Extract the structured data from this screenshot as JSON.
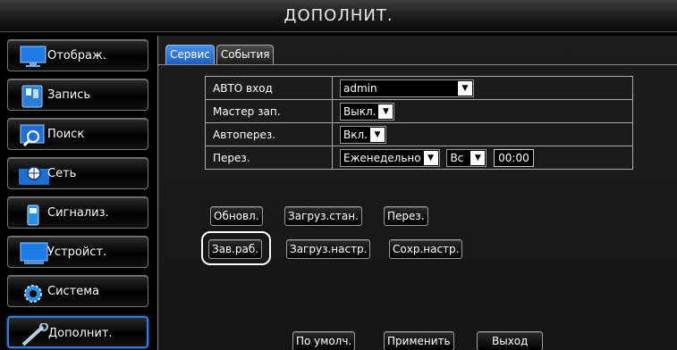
{
  "window": {
    "title": "ДОПОЛНИТ."
  },
  "sidebar": {
    "items": [
      {
        "label": "Отображ.",
        "icon": "monitor-icon"
      },
      {
        "label": "Запись",
        "icon": "record-icon"
      },
      {
        "label": "Поиск",
        "icon": "search-icon"
      },
      {
        "label": "Сеть",
        "icon": "network-icon"
      },
      {
        "label": "Сигнализ.",
        "icon": "alarm-icon"
      },
      {
        "label": "Устройст.",
        "icon": "device-icon"
      },
      {
        "label": "Система",
        "icon": "gear-icon"
      },
      {
        "label": "Дополнит.",
        "icon": "tools-icon"
      }
    ],
    "active_index": 7
  },
  "tabs": [
    {
      "label": "Сервис"
    },
    {
      "label": "События"
    }
  ],
  "settings": {
    "auto_login": {
      "label": "АВТО вход",
      "value": "admin"
    },
    "wizard": {
      "label": "Мастер зап.",
      "value": "Выкл."
    },
    "auto_reboot": {
      "label": "Автоперез.",
      "value": "Вкл."
    },
    "reboot": {
      "label": "Перез.",
      "period": "Еженедельно",
      "day": "Вс",
      "time": "00:00"
    }
  },
  "buttons": {
    "update": "Обновл.",
    "load_default": "Загруз.стан.",
    "reboot": "Перез.",
    "shutdown": "Зав.раб.",
    "load_settings": "Загруз.настр.",
    "save_settings": "Сохр.настр.",
    "default": "По умолч.",
    "apply": "Применить",
    "exit": "Выход"
  },
  "colors": {
    "accent": "#2a6bd0",
    "tab_active": "#3b7fe0"
  }
}
